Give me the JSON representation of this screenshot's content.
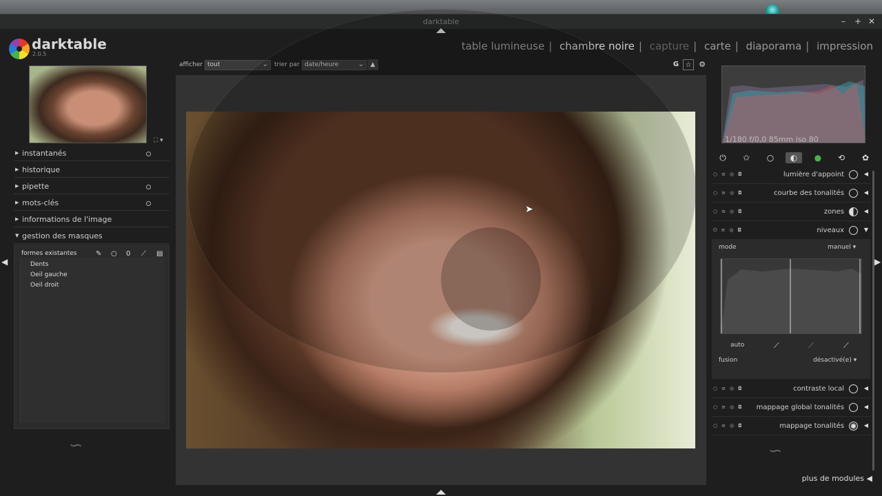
{
  "window": {
    "title": "darktable"
  },
  "app": {
    "name": "darktable",
    "version": "2.0.5"
  },
  "views": [
    {
      "label": "table lumineuse",
      "state": "normal"
    },
    {
      "label": "chambre noire",
      "state": "active"
    },
    {
      "label": "capture",
      "state": "dim"
    },
    {
      "label": "carte",
      "state": "normal"
    },
    {
      "label": "diaporama",
      "state": "normal"
    },
    {
      "label": "impression",
      "state": "normal"
    }
  ],
  "filterbar": {
    "show_label": "afficher",
    "show_value": "tout",
    "sort_label": "trier par",
    "sort_value": "date/heure",
    "g_button": "G"
  },
  "left_panel": {
    "modules": [
      {
        "label": "instantanés",
        "has_dot": true
      },
      {
        "label": "historique",
        "has_dot": false
      },
      {
        "label": "pipette",
        "has_dot": true
      },
      {
        "label": "mots-clés",
        "has_dot": true
      },
      {
        "label": "informations de l'image",
        "has_dot": false
      },
      {
        "label": "gestion des masques",
        "has_dot": false,
        "expanded": true
      }
    ],
    "masks": {
      "header": "formes existantes",
      "shapes": [
        "Dents",
        "Oeil gauche",
        "Oeil droit"
      ]
    }
  },
  "histogram": {
    "info": "1/180 f/0,0 85mm iso 80"
  },
  "right_panel": {
    "modules_top": [
      {
        "label": "lumière d'appoint",
        "icon": "fill-light-icon"
      },
      {
        "label": "courbe des tonalités",
        "icon": "tone-curve-icon"
      },
      {
        "label": "zones",
        "icon": "zones-icon"
      },
      {
        "label": "niveaux",
        "icon": "levels-icon",
        "expanded": true
      }
    ],
    "niveaux": {
      "mode_label": "mode",
      "mode_value": "manuel",
      "auto_label": "auto",
      "fusion_label": "fusion",
      "fusion_value": "désactivé(e)"
    },
    "modules_bottom": [
      {
        "label": "contraste local",
        "icon": "local-contrast-icon"
      },
      {
        "label": "mappage global tonalités",
        "icon": "global-tonemap-icon"
      },
      {
        "label": "mappage tonalités",
        "icon": "tonemap-icon"
      }
    ],
    "more_modules": "plus de modules"
  }
}
